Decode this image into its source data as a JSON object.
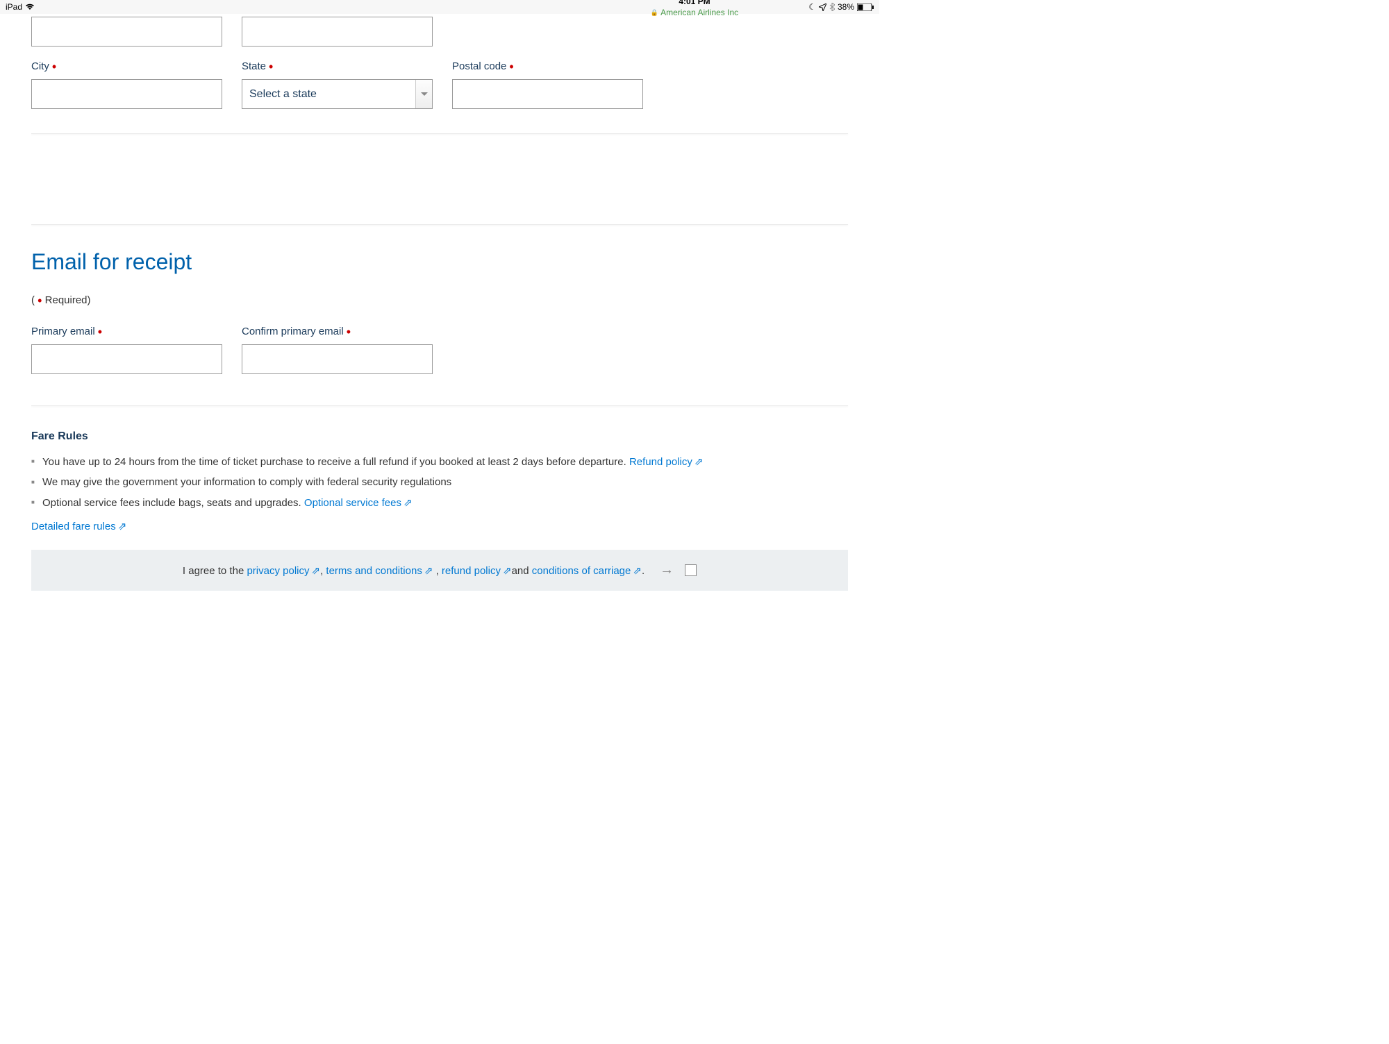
{
  "status": {
    "device": "iPad",
    "time": "4:01 PM",
    "site": "American Airlines Inc",
    "battery": "38%"
  },
  "address": {
    "city_label": "City",
    "state_label": "State",
    "state_placeholder": "Select a state",
    "postal_label": "Postal code"
  },
  "email_section": {
    "title": "Email for receipt",
    "required_text": "Required)",
    "primary_label": "Primary email",
    "confirm_label": "Confirm primary email"
  },
  "fare": {
    "heading": "Fare Rules",
    "rule1": "You have up to 24 hours from the time of ticket purchase to receive a full refund if you booked at least 2 days before departure. ",
    "refund_link": "Refund policy",
    "rule2": "We may give the government your information to comply with federal security regulations",
    "rule3a": "Optional service fees include bags, seats and upgrades. ",
    "optional_link": "Optional service fees",
    "detailed_link": "Detailed fare rules"
  },
  "agree": {
    "prefix": "I agree to the ",
    "privacy": "privacy policy",
    "comma1": ", ",
    "terms": "terms and conditions",
    "comma2": " , ",
    "refund": "refund policy",
    "and": "and ",
    "carriage": "conditions of carriage",
    "period": "."
  }
}
